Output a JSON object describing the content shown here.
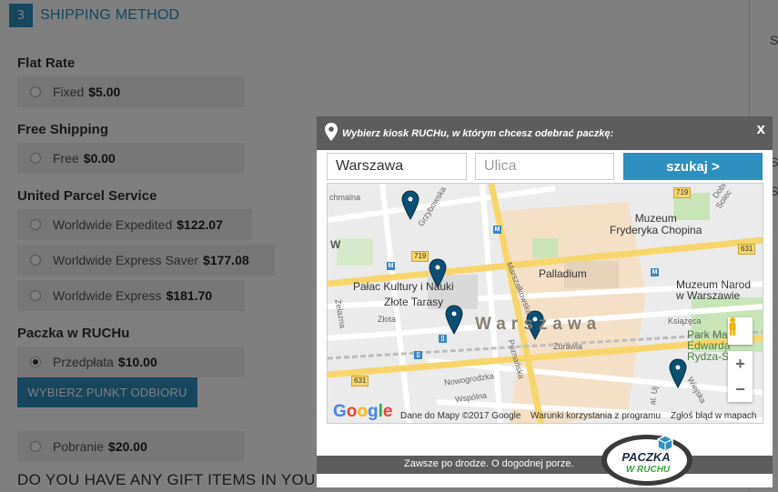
{
  "step": {
    "number": "3",
    "title": "SHIPPING METHOD"
  },
  "side_letters": [
    "S",
    "S",
    "S"
  ],
  "groups": [
    {
      "name": "Flat Rate",
      "options": [
        {
          "label": "Fixed",
          "price": "$5.00"
        }
      ]
    },
    {
      "name": "Free Shipping",
      "options": [
        {
          "label": "Free",
          "price": "$0.00"
        }
      ]
    },
    {
      "name": "United Parcel Service",
      "options": [
        {
          "label": "Worldwide Expedited",
          "price": "$122.07"
        },
        {
          "label": "Worldwide Express Saver",
          "price": "$177.08"
        },
        {
          "label": "Worldwide Express",
          "price": "$181.70"
        }
      ]
    },
    {
      "name": "Paczka w RUCHu",
      "options": [
        {
          "label": "Przedpłata",
          "price": "$10.00",
          "selected": true
        },
        {
          "label": "Pobranie",
          "price": "$20.00"
        }
      ]
    }
  ],
  "pick_point_button": "WYBIERZ PUNKT ODBIORU",
  "gift_heading": "DO YOU HAVE ANY GIFT ITEMS IN YOU",
  "modal": {
    "title": "Wybierz kiosk RUCHu, w którym chcesz odebrać paczkę:",
    "close": "x",
    "city_value": "Warszawa",
    "street_placeholder": "Ulica",
    "search_button": "szukaj >",
    "footer_slogan": "Zawsze po drodze. O dogodnej porze.",
    "logo_text_top": "PACZKA",
    "logo_text_bottom": "W RUCHU"
  },
  "map": {
    "places": {
      "muzeum_chopina": "Muzeum\nFryderyka Chopina",
      "palladium": "Palladium",
      "palac": "Pałac Kultury i Nauki",
      "zlote_tarasy": "Złote Tarasy",
      "muzeum_narodowe": "Muzeum Narod\nw Warszawie",
      "park": "Park Marsz\nEdwarda\nRydza-Śmigł"
    },
    "district": "Warszawa",
    "streets": {
      "chmielna": "chmalna",
      "grzybowska": "Grzybowska",
      "marszalkowska": "Marszałkowska",
      "zelazna": "Żelazna",
      "zlota": "Złota",
      "poznanska": "Poznańska",
      "zurawia": "Żurawia",
      "nowogrodzka": "Nowogrodzka",
      "wspolna": "Wspólna",
      "ksiazeca": "Książęca",
      "dobra": "Dobra",
      "solec": "Solec",
      "wiejska": "Wiejska",
      "ujazd": "al. Uj"
    },
    "road_numbers": [
      "719",
      "719",
      "631",
      "631"
    ],
    "w_letter": "W",
    "google": "Google",
    "attribution": [
      "Dane do Mapy ©2017 Google",
      "Warunki korzystania z programu",
      "Zgłoś błąd w mapach"
    ],
    "zoom_in": "+",
    "zoom_out": "−"
  }
}
